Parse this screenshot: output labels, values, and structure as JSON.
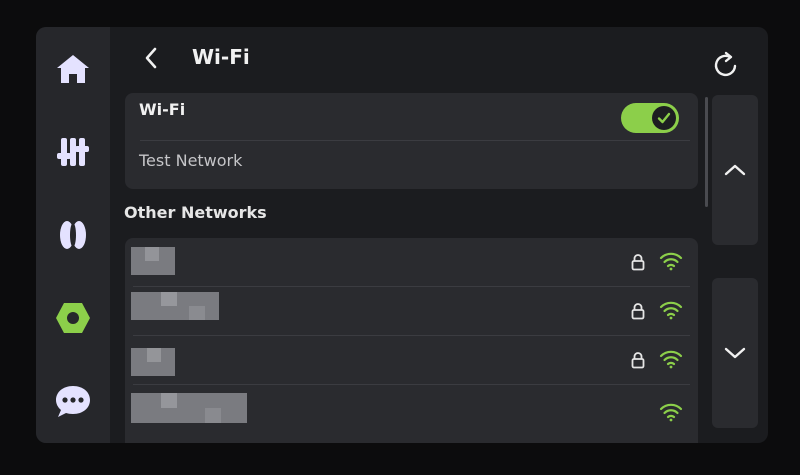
{
  "sidebar": {
    "items": [
      {
        "icon": "home-icon",
        "active": false
      },
      {
        "icon": "sliders-icon",
        "active": false
      },
      {
        "icon": "filament-icon",
        "active": false
      },
      {
        "icon": "settings-hex-icon",
        "active": true
      },
      {
        "icon": "chat-icon",
        "active": false
      }
    ],
    "active_color": "#8ccf4a",
    "icon_color": "#e4e2ff"
  },
  "header": {
    "title": "Wi-Fi",
    "back_icon": "chevron-left-icon",
    "refresh_icon": "refresh-icon"
  },
  "wifi": {
    "label": "Wi-Fi",
    "enabled": true,
    "current_network": "Test Network"
  },
  "other_networks": {
    "title": "Other Networks",
    "items": [
      {
        "name": "",
        "secured": true,
        "signal_color": "#8ccf4a"
      },
      {
        "name": "",
        "secured": true,
        "signal_color": "#8ccf4a"
      },
      {
        "name": "",
        "secured": true,
        "signal_color": "#8ccf4a"
      },
      {
        "name": "",
        "secured": false,
        "signal_color": "#8ccf4a"
      }
    ]
  },
  "scroll": {
    "up_icon": "chevron-up-icon",
    "down_icon": "chevron-down-icon"
  }
}
